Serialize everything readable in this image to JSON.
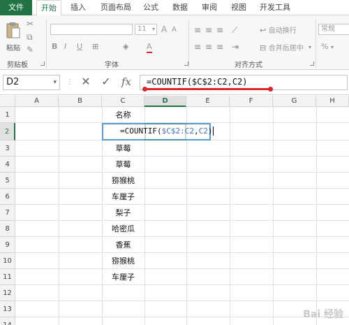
{
  "tabs": {
    "file": "文件",
    "home": "开始",
    "insert": "插入",
    "page_layout": "页面布局",
    "formulas": "公式",
    "data": "数据",
    "review": "审阅",
    "view": "视图",
    "developer": "开发工具"
  },
  "ribbon": {
    "paste_label": "粘贴",
    "font_size": "11",
    "bold": "B",
    "italic": "I",
    "underline": "U",
    "font_color_letter": "A",
    "grow_font": "A",
    "shrink_font": "A",
    "wrap_text": "自动换行",
    "merge_center": "合并后居中",
    "number_format": "常规",
    "percent": "%",
    "groups": {
      "clipboard": "剪贴板",
      "font": "字体",
      "alignment": "对齐方式"
    }
  },
  "formula_bar": {
    "name_box": "D2",
    "cancel": "✕",
    "enter": "✓",
    "fx": "fx",
    "formula": "=COUNTIF($C$2:C2,C2)"
  },
  "sheet": {
    "columns": [
      "A",
      "B",
      "C",
      "D",
      "E",
      "F",
      "G",
      "H"
    ],
    "selected_column": "D",
    "rows": [
      "1",
      "2",
      "3",
      "4",
      "5",
      "6",
      "7",
      "8",
      "9",
      "10",
      "11",
      "12",
      "13",
      "14"
    ],
    "selected_row": "2",
    "column_c": [
      "名称",
      "",
      "草莓",
      "草莓",
      "猕猴桃",
      "车厘子",
      "梨子",
      "哈密瓜",
      "香蕉",
      "猕猴桃",
      "车厘子"
    ],
    "editing_cell": {
      "prefix": "=COUNTIF(",
      "ref1": "$C$2:C2",
      "comma": ",",
      "ref2": "C2",
      "suffix": ")"
    }
  },
  "watermark": "Bai 经验",
  "colors": {
    "excel_green": "#217346",
    "annotation_red": "#d9272e",
    "reference_blue": "#4472c4"
  }
}
